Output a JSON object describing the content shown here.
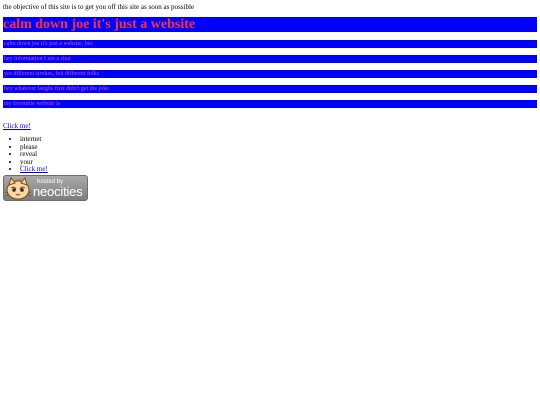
{
  "intro_text": "the objective of this site is to get you off this site as soon as possible",
  "hero": {
    "title": "calm down joe it's just a website"
  },
  "bars": [
    {
      "text": "calm down joe it's just a website, bet."
    },
    {
      "text": "hey information I am a chat"
    },
    {
      "text": "yes different strokes, feit different folks"
    },
    {
      "text": "hey whatever laughs first didn't get the joke"
    },
    {
      "text": "my favourite website is"
    }
  ],
  "click_link_1": "Click me!",
  "list": {
    "items": [
      "internet",
      "please",
      "reveal",
      "your"
    ],
    "link_label": "Click me!"
  },
  "badge": {
    "top_text": "hosted by",
    "brand_text": "neocities",
    "cat_icon": "neocities-cat-icon"
  },
  "colors": {
    "bar_blue": "#0000ff",
    "hero_text": "#ff3333",
    "bar_text": "#c84fd8",
    "link": "#0000ee"
  }
}
